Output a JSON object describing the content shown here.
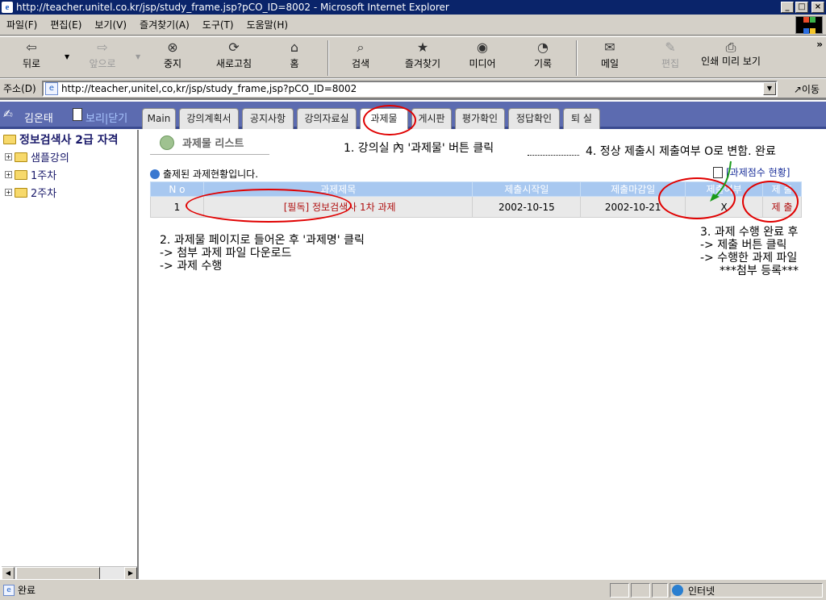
{
  "window": {
    "title": "http://teacher.unitel.co.kr/jsp/study_frame.jsp?pCO_ID=8002 - Microsoft Internet Explorer",
    "buttons": [
      "_",
      "□",
      "×"
    ]
  },
  "menu": [
    "파일(F)",
    "편집(E)",
    "보기(V)",
    "즐겨찾기(A)",
    "도구(T)",
    "도움말(H)"
  ],
  "toolbar": {
    "back": "뒤로",
    "forward": "앞으로",
    "stop": "중지",
    "refresh": "새로고침",
    "home": "홈",
    "search": "검색",
    "favorites": "즐겨찾기",
    "media": "미디어",
    "history": "기록",
    "mail": "메일",
    "edit": "편집",
    "print_preview": "인쇄 미리 보기",
    "more": "»"
  },
  "address": {
    "label": "주소(D)",
    "url": "http://teacher,unitel,co,kr/jsp/study_frame,jsp?pCO_ID=8002",
    "go": "이동"
  },
  "header": {
    "user_name": "김온태",
    "shortcut": "보리|닫기",
    "tabs": [
      "Main",
      "강의계획서",
      "공지사항",
      "강의자료실",
      "과제물",
      "게시판",
      "평가확인",
      "정답확인",
      "퇴 실"
    ]
  },
  "tree": {
    "root": "정보검색사 2급 자격",
    "items": [
      "샘플강의",
      "1주차",
      "2주차"
    ]
  },
  "main": {
    "section_title": "과제물 리스트",
    "subtitle": "출제된 과제현황입니다.",
    "score_link": "[과제점수 현황]",
    "table": {
      "headers": [
        "N o",
        "과제제목",
        "제출시작일",
        "제출마감일",
        "제출여부",
        "제 출"
      ],
      "rows": [
        {
          "no": "1",
          "title": "[필독] 정보검색사 1차 과제",
          "start": "2002-10-15",
          "end": "2002-10-21",
          "submitted": "X",
          "submit": "제 출"
        }
      ]
    }
  },
  "annotations": {
    "note1": "1. 강의실 內 '과제물' 버튼 클릭",
    "note2_line1": "2. 과제물 페이지로 들어온 후 '과제명' 클릭",
    "note2_line2": "-> 첨부 과제 파일 다운로드",
    "note2_line3": "-> 과제 수행",
    "note3_line1": "3. 과제 수행 완료 후",
    "note3_line2": "-> 제출 버튼 클릭",
    "note3_line3": "-> 수행한 과제 파일",
    "note3_line4": "***첨부 등록***",
    "note4": "4. 정상 제출시 제출여부 O로 변함. 완료"
  },
  "status": {
    "text": "완료",
    "zone": "인터넷"
  },
  "colors": {
    "title_bar": "#0a246a",
    "header_band": "#5c6bb0",
    "table_header": "#a8c8f0",
    "annotation_red": "#e00000",
    "link_red": "#b01010"
  }
}
